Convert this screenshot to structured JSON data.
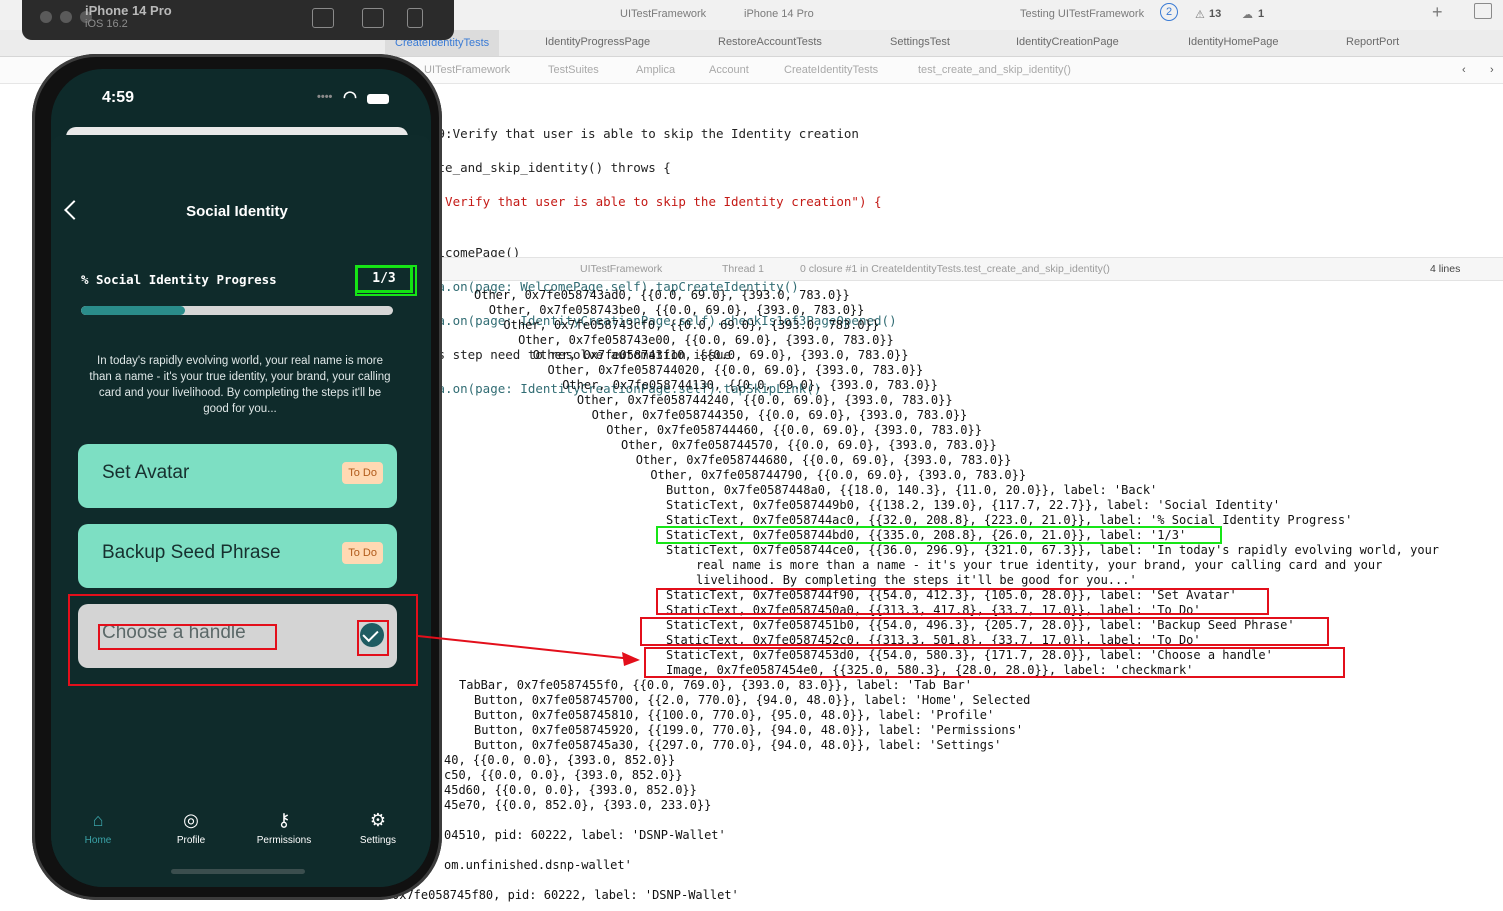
{
  "toolbar": {
    "scheme": "UITestFramework",
    "device": "iPhone 14 Pro",
    "status": "Testing UITestFramework",
    "status_count": "2",
    "warnings": "13",
    "errors": "1"
  },
  "simulator": {
    "title": "iPhone 14 Pro",
    "subtitle": "iOS 16.2"
  },
  "tabs": [
    "CreateIdentityTests",
    "IdentityProgressPage",
    "RestoreAccountTests",
    "SettingsTest",
    "IdentityCreationPage",
    "IdentityHomePage",
    "ReportPort"
  ],
  "breadcrumb": [
    "UITestFramework",
    "TestSuites",
    "Amplica",
    "Account",
    "CreateIdentityTests",
    "test_create_and_skip_identity()"
  ],
  "code_lines": [
    "59:Verify that user is able to skip the Identity creation",
    "ate_and_skip_identity() throws {",
    ": Verify that user is able to skip the Identity creation\") {",
    "",
    "elcomePage()",
    "ca.on(page: WelcomePage.self).tapCreateIdentity()",
    "ca.on(page: IdentityCreationPage.self).checkIs1of3PageOpened()",
    "is step need to resolve automation issue",
    "ca.on(page: IdentityCreationPage.self).tapSkipLink()"
  ],
  "debug_bar": {
    "target": "UITestFramework",
    "thread": "Thread 1",
    "frame": "0 closure #1 in CreateIdentityTests.test_create_and_skip_identity()",
    "lines": "4 lines"
  },
  "console_lines": [
    "Other, 0x7fe058743ad0, {{0.0, 69.0}, {393.0, 783.0}}",
    "Other, 0x7fe058743be0, {{0.0, 69.0}, {393.0, 783.0}}",
    "Other, 0x7fe058743cf0, {{0.0, 69.0}, {393.0, 783.0}}",
    "Other, 0x7fe058743e00, {{0.0, 69.0}, {393.0, 783.0}}",
    "Other, 0x7fe058743f10, {{0.0, 69.0}, {393.0, 783.0}}",
    "Other, 0x7fe058744020, {{0.0, 69.0}, {393.0, 783.0}}",
    "Other, 0x7fe058744130, {{0.0, 69.0}, {393.0, 783.0}}",
    "Other, 0x7fe058744240, {{0.0, 69.0}, {393.0, 783.0}}",
    "Other, 0x7fe058744350, {{0.0, 69.0}, {393.0, 783.0}}",
    "Other, 0x7fe058744460, {{0.0, 69.0}, {393.0, 783.0}}",
    "Other, 0x7fe058744570, {{0.0, 69.0}, {393.0, 783.0}}",
    "Other, 0x7fe058744680, {{0.0, 69.0}, {393.0, 783.0}}",
    "Other, 0x7fe058744790, {{0.0, 69.0}, {393.0, 783.0}}",
    "Button, 0x7fe0587448a0, {{18.0, 140.3}, {11.0, 20.0}}, label: 'Back'",
    "StaticText, 0x7fe0587449b0, {{138.2, 139.0}, {117.7, 22.7}}, label: 'Social Identity'",
    "StaticText, 0x7fe058744ac0, {{32.0, 208.8}, {223.0, 21.0}}, label: '% Social Identity Progress'",
    "StaticText, 0x7fe058744bd0, {{335.0, 208.8}, {26.0, 21.0}}, label: '1/3'",
    "StaticText, 0x7fe058744ce0, {{36.0, 296.9}, {321.0, 67.3}}, label: 'In today's rapidly evolving world, your",
    "real name is more than a name - it's your true identity, your brand, your calling card and your",
    "livelihood. By completing the steps it'll be good for you...'",
    "StaticText, 0x7fe058744f90, {{54.0, 412.3}, {105.0, 28.0}}, label: 'Set Avatar'",
    "StaticText, 0x7fe0587450a0, {{313.3, 417.8}, {33.7, 17.0}}, label: 'To Do'",
    "StaticText, 0x7fe0587451b0, {{54.0, 496.3}, {205.7, 28.0}}, label: 'Backup Seed Phrase'",
    "StaticText, 0x7fe0587452c0, {{313.3, 501.8}, {33.7, 17.0}}, label: 'To Do'",
    "StaticText, 0x7fe0587453d0, {{54.0, 580.3}, {171.7, 28.0}}, label: 'Choose a handle'",
    "Image, 0x7fe0587454e0, {{325.0, 580.3}, {28.0, 28.0}}, label: 'checkmark'",
    "TabBar, 0x7fe0587455f0, {{0.0, 769.0}, {393.0, 83.0}}, label: 'Tab Bar'",
    "Button, 0x7fe058745700, {{2.0, 770.0}, {94.0, 48.0}}, label: 'Home', Selected",
    "Button, 0x7fe058745810, {{100.0, 770.0}, {95.0, 48.0}}, label: 'Profile'",
    "Button, 0x7fe058745920, {{199.0, 770.0}, {94.0, 48.0}}, label: 'Permissions'",
    "Button, 0x7fe058745a30, {{297.0, 770.0}, {94.0, 48.0}}, label: 'Settings'",
    "40, {{0.0, 0.0}, {393.0, 852.0}}",
    "c50, {{0.0, 0.0}, {393.0, 852.0}}",
    "45d60, {{0.0, 0.0}, {393.0, 852.0}}",
    "45e70, {{0.0, 852.0}, {393.0, 233.0}}",
    "04510, pid: 60222, label: 'DSNP-Wallet'",
    "om.unfinished.dsnp-wallet'",
    "0x7fe058745f80, pid: 60222, label: 'DSNP-Wallet'"
  ],
  "app": {
    "time": "4:59",
    "nav_title": "Social Identity",
    "progress_label": "% Social Identity Progress",
    "progress_count": "1/3",
    "progress_fraction": 0.333,
    "intro": "In today's rapidly evolving world, your real name is more than a name - it's your true identity, your brand, your calling card and your livelihood. By completing the steps it'll be good for you...",
    "cards": [
      {
        "label": "Set Avatar",
        "badge": "To Do"
      },
      {
        "label": "Backup Seed Phrase",
        "badge": "To Do"
      },
      {
        "label": "Choose a handle",
        "icon": "checkmark-icon"
      }
    ],
    "tabbar": [
      {
        "label": "Home",
        "icon": "home-icon"
      },
      {
        "label": "Profile",
        "icon": "fingerprint-icon"
      },
      {
        "label": "Permissions",
        "icon": "key-icon"
      },
      {
        "label": "Settings",
        "icon": "gear-icon"
      }
    ]
  },
  "colors": {
    "annotation_red": "#e30f1b",
    "annotation_green": "#17e517",
    "screen_bg": "#0f2b2b",
    "card_green": "#7ddfc3",
    "accent": "#3aa3a8"
  }
}
